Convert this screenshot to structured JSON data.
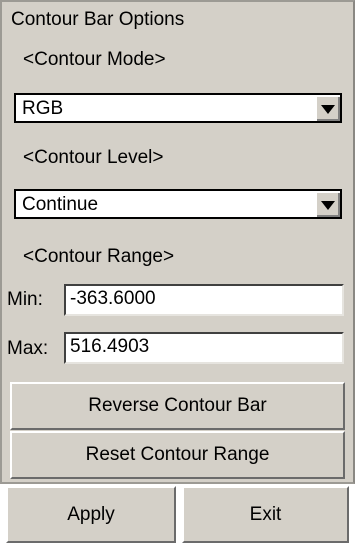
{
  "panel": {
    "title": "Contour Bar Options",
    "mode_label": "<Contour Mode>",
    "mode_value": "RGB",
    "level_label": "<Contour Level>",
    "level_value": "Continue",
    "range_label": "<Contour Range>",
    "min_label": "Min:",
    "min_value": "-363.6000",
    "max_label": "Max:",
    "max_value": "516.4903",
    "reverse_label": "Reverse Contour Bar",
    "reset_label": "Reset Contour Range"
  },
  "footer": {
    "apply_label": "Apply",
    "exit_label": "Exit"
  }
}
